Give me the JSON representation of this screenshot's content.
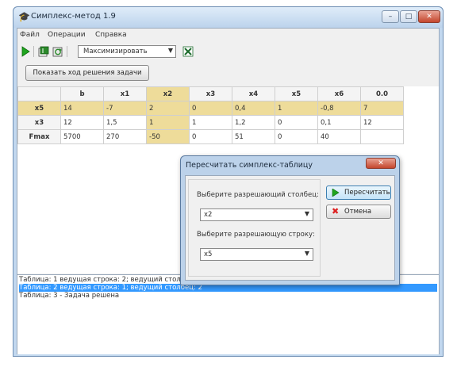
{
  "window": {
    "title": "Симплекс-метод 1.9",
    "app_icon": "graduation-cap-icon"
  },
  "caption_buttons": {
    "minimize": "–",
    "maximize": "□",
    "close": "✕"
  },
  "menu": [
    "Файл",
    "Операции",
    "Справка"
  ],
  "toolbar": {
    "icons": [
      "play-icon",
      "new-table-icon",
      "refresh-icon",
      "excel-icon"
    ],
    "mode_value": "Максимизировать"
  },
  "show_solution_button": "Показать ход решения задачи",
  "table": {
    "headers": [
      "",
      "b",
      "x1",
      "x2",
      "x3",
      "x4",
      "x5",
      "x6",
      "0.0"
    ],
    "rows": [
      {
        "label": "x5",
        "cells": [
          "14",
          "-7",
          "2",
          "0",
          "0,4",
          "1",
          "-0,8",
          "7"
        ]
      },
      {
        "label": "x3",
        "cells": [
          "12",
          "1,5",
          "1",
          "1",
          "1,2",
          "0",
          "0,1",
          "12"
        ]
      },
      {
        "label": "Fmax",
        "cells": [
          "5700",
          "270",
          "-50",
          "0",
          "51",
          "0",
          "40",
          ""
        ]
      }
    ],
    "highlight_color": "#eedc9a"
  },
  "log": [
    "Таблица: 1 ведущая строка: 2; ведущий столбец: 1",
    "Таблица: 2 ведущая строка: 1; ведущий столбец: 2",
    "Таблица: 3 - Задача решена"
  ],
  "dialog": {
    "title": "Пересчитать симплекс-таблицу",
    "close": "✕",
    "column_label": "Выберите разрешающий столбец:",
    "column_value": "x2",
    "row_label": "Выберите разрешающую строку:",
    "row_value": "x5",
    "recalc_button": "Пересчитать",
    "cancel_button": "Отмена"
  }
}
